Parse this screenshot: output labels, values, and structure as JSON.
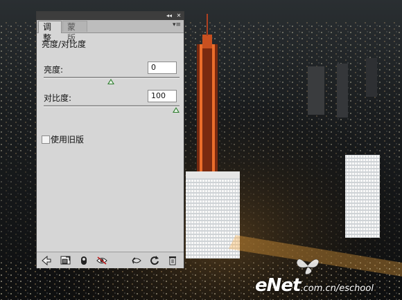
{
  "panel": {
    "tabs": [
      {
        "label": "调整",
        "active": true
      },
      {
        "label": "蒙版",
        "active": false
      }
    ],
    "title": "亮度/对比度",
    "brightness": {
      "label": "亮度:",
      "value": "0"
    },
    "contrast": {
      "label": "对比度:",
      "value": "100"
    },
    "legacy": {
      "label": "使用旧版",
      "checked": false
    },
    "footer_icons": [
      "back-arrow-icon",
      "expand-view-icon",
      "clip-to-layer-icon",
      "visibility-eye-icon",
      "view-previous-state-icon",
      "reset-icon",
      "trash-icon"
    ]
  },
  "watermark": {
    "brand": "eNet",
    "url": ".com.cn/eschool"
  },
  "colors": {
    "panel_bg": "#d6d6d6",
    "slider_thumb": "#2e7d2e",
    "titlebar": "#3d3d3d"
  }
}
